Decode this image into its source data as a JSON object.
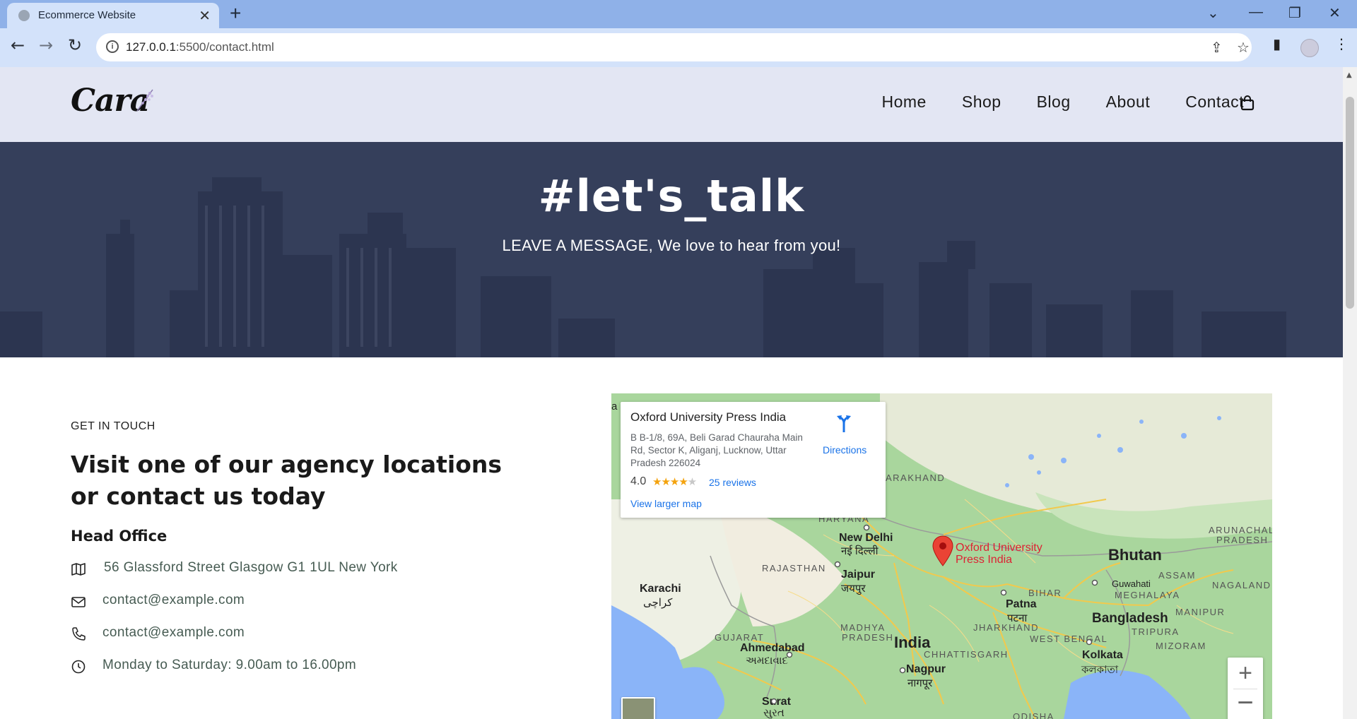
{
  "browser": {
    "tab_title": "Ecommerce Website",
    "tab_close": "✕",
    "new_tab": "+",
    "url_host": "127.0.0.1",
    "url_rest": ":5500/contact.html",
    "window_controls": [
      "⌄",
      "—",
      "❐",
      "✕"
    ],
    "info_icon": "i"
  },
  "site": {
    "logo": "Cara",
    "nav": [
      "Home",
      "Shop",
      "Blog",
      "About",
      "Contact"
    ]
  },
  "banner": {
    "title": "#let's_talk",
    "subtitle": "LEAVE A MESSAGE, We love to hear from you!"
  },
  "contact": {
    "eyebrow": "GET IN TOUCH",
    "headline": "Visit one of our agency locations or contact us today",
    "office_title": "Head Office",
    "rows": [
      {
        "icon": "map-icon",
        "text": "56 Glassford Street Glasgow G1 1UL New York"
      },
      {
        "icon": "envelope-icon",
        "text": "contact@example.com"
      },
      {
        "icon": "phone-icon",
        "text": "contact@example.com"
      },
      {
        "icon": "clock-icon",
        "text": "Monday to Saturday: 9.00am to 16.00pm"
      }
    ]
  },
  "map": {
    "place_name": "Oxford University Press India",
    "address": "B B-1/8, 69A, Beli Garad Chauraha Main Rd, Sector K, Aliganj, Lucknow, Uttar Pradesh 226024",
    "rating": "4.0",
    "stars": "★★★★",
    "star_empty": "★",
    "reviews": "25 reviews",
    "view_larger": "View larger map",
    "directions": "Directions",
    "zoom_in": "+",
    "zoom_out": "−",
    "labels": {
      "india": "India",
      "bhutan": "Bhutan",
      "bangladesh": "Bangladesh",
      "karachi": "Karachi",
      "karachi_native": "کراچی",
      "new_delhi": "New Delhi",
      "new_delhi_native": "नई दिल्ली",
      "jaipur": "Jaipur",
      "jaipur_native": "जयपुर",
      "ahmedabad": "Ahmedabad",
      "ahmedabad_native": "અમદાવાદ",
      "surat": "Surat",
      "surat_native": "સુરત",
      "nagpur": "Nagpur",
      "nagpur_native": "नागपूर",
      "patna": "Patna",
      "patna_native": "पटना",
      "kolkata": "Kolkata",
      "kolkata_native": "কলকাতা",
      "guwahati": "Guwahati",
      "pin_line1": "Oxford University",
      "pin_line2": "Press India",
      "rajasthan": "RAJASTHAN",
      "haryana": "HARYANA",
      "uttarakhand": "ARAKHAND",
      "gujarat": "GUJARAT",
      "madhya": "MADHYA",
      "pradesh": "PRADESH",
      "chhattisgarh": "CHHATTISGARH",
      "jharkhand": "JHARKHAND",
      "bihar": "BIHAR",
      "west_bengal": "WEST BENGAL",
      "odisha": "ODISHA",
      "assam": "ASSAM",
      "meghalaya": "MEGHALAYA",
      "nagaland": "NAGALAND",
      "manipur": "MANIPUR",
      "tripura": "TRIPURA",
      "mizoram": "MIZORAM",
      "arunachal": "ARUNACHAL",
      "arunachal2": "PRADESH",
      "edge_a": "a"
    }
  }
}
